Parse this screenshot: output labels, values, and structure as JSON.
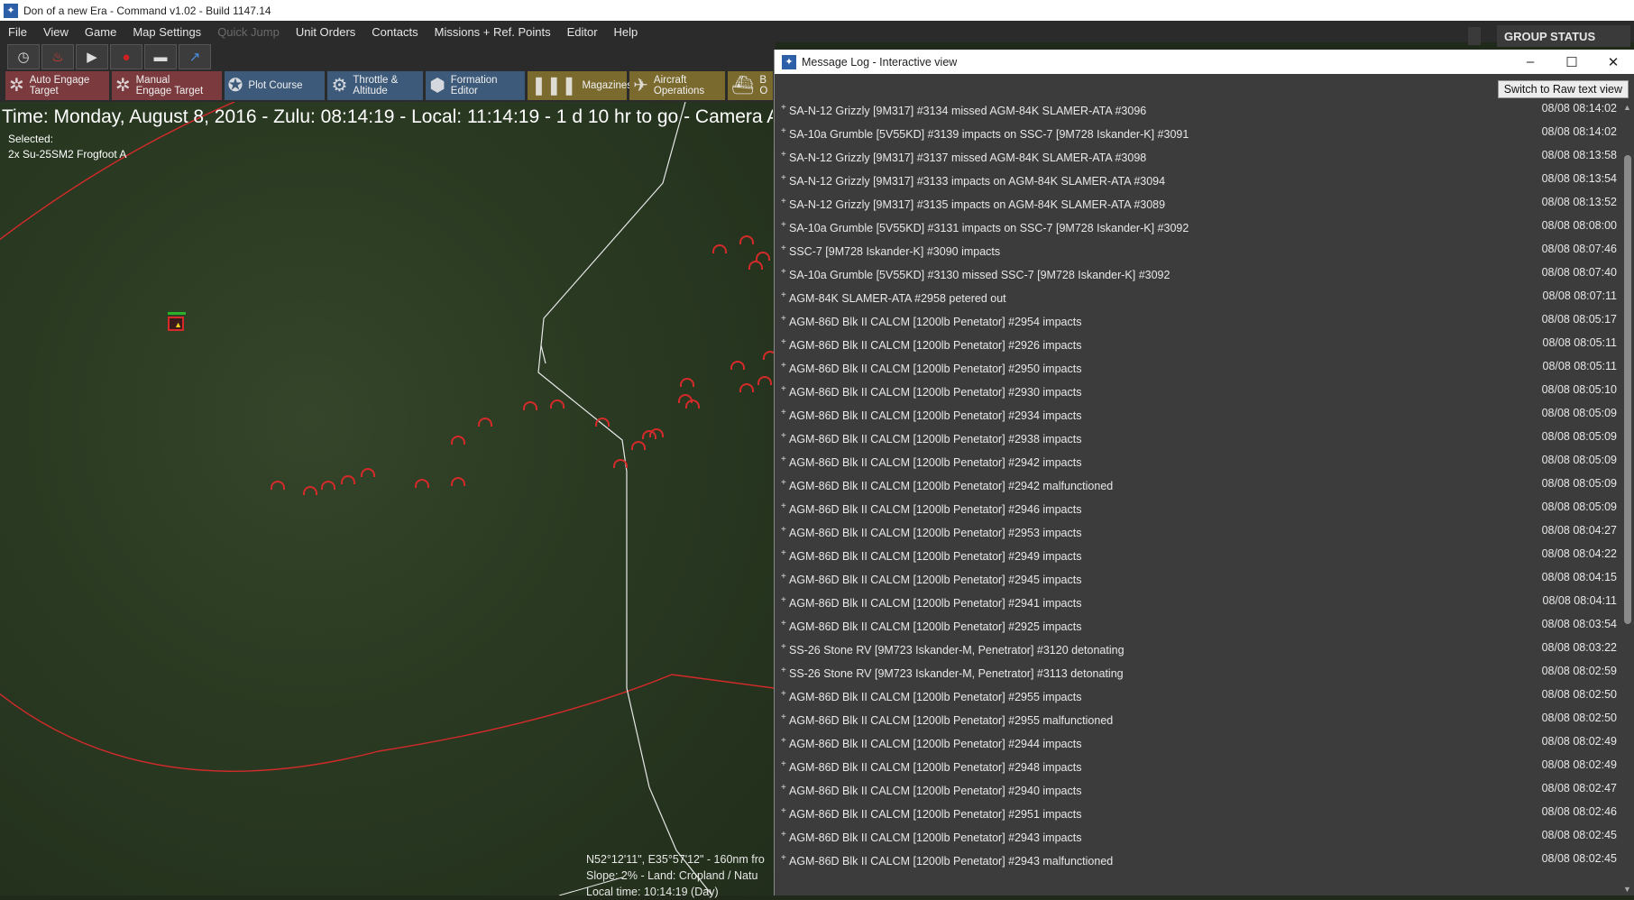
{
  "app": {
    "title": "Don of a new Era - Command v1.02 - Build 1147.14"
  },
  "menu": [
    "File",
    "View",
    "Game",
    "Map Settings",
    "Quick Jump",
    "Unit Orders",
    "Contacts",
    "Missions + Ref. Points",
    "Editor",
    "Help"
  ],
  "menu_disabled": [
    "Quick Jump"
  ],
  "toolbar_icons": [
    "clock-icon",
    "fire-icon",
    "play-icon",
    "record-icon",
    "ship-icon",
    "arrow-icon"
  ],
  "actions": [
    {
      "line1": "Auto Engage",
      "line2": "Target"
    },
    {
      "line1": "Manual",
      "line2": "Engage Target"
    },
    {
      "line1": "Plot Course",
      "line2": ""
    },
    {
      "line1": "Throttle &",
      "line2": "Altitude"
    },
    {
      "line1": "Formation",
      "line2": "Editor"
    },
    {
      "line1": "Magazines",
      "line2": ""
    },
    {
      "line1": "Aircraft",
      "line2": "Operations"
    },
    {
      "line1": "B",
      "line2": "O"
    }
  ],
  "map": {
    "time_line": "Time: Monday, August 8, 2016 - Zulu: 08:14:19 - Local: 11:14:19 - 1 d 10 hr to go -  Camera A",
    "selected_label": "Selected:",
    "selected_unit": "2x Su-25SM2 Frogfoot A",
    "coords_line1": "N52°12'11\", E35°57'12\" - 160nm fro",
    "coords_line2": "Slope: 2% - Land: Cropland / Natu",
    "coords_line3": "Local time: 10:14:19 (Day)"
  },
  "group_status": {
    "label": "GROUP STATUS"
  },
  "message_log": {
    "title": "Message Log - Interactive view",
    "raw_button": "Switch to Raw text view",
    "rows": [
      {
        "text": "SA-N-12 Grizzly [9M317] #3134 missed AGM-84K SLAMER-ATA #3096",
        "time": "08/08 08:14:02"
      },
      {
        "text": "SA-10a Grumble [5V55KD] #3139 impacts on SSC-7 [9M728 Iskander-K] #3091",
        "time": "08/08 08:14:02"
      },
      {
        "text": "SA-N-12 Grizzly [9M317] #3137 missed AGM-84K SLAMER-ATA #3098",
        "time": "08/08 08:13:58"
      },
      {
        "text": "SA-N-12 Grizzly [9M317] #3133 impacts on AGM-84K SLAMER-ATA #3094",
        "time": "08/08 08:13:54"
      },
      {
        "text": "SA-N-12 Grizzly [9M317] #3135 impacts on AGM-84K SLAMER-ATA #3089",
        "time": "08/08 08:13:52"
      },
      {
        "text": "SA-10a Grumble [5V55KD] #3131 impacts on SSC-7 [9M728 Iskander-K] #3092",
        "time": "08/08 08:08:00"
      },
      {
        "text": "SSC-7 [9M728 Iskander-K] #3090 impacts",
        "time": "08/08 08:07:46"
      },
      {
        "text": "SA-10a Grumble [5V55KD] #3130 missed SSC-7 [9M728 Iskander-K] #3092",
        "time": "08/08 08:07:40"
      },
      {
        "text": "AGM-84K SLAMER-ATA #2958 petered out",
        "time": "08/08 08:07:11"
      },
      {
        "text": "AGM-86D Blk II CALCM [1200lb Penetator] #2954 impacts",
        "time": "08/08 08:05:17"
      },
      {
        "text": "AGM-86D Blk II CALCM [1200lb Penetator] #2926 impacts",
        "time": "08/08 08:05:11"
      },
      {
        "text": "AGM-86D Blk II CALCM [1200lb Penetator] #2950 impacts",
        "time": "08/08 08:05:11"
      },
      {
        "text": "AGM-86D Blk II CALCM [1200lb Penetator] #2930 impacts",
        "time": "08/08 08:05:10"
      },
      {
        "text": "AGM-86D Blk II CALCM [1200lb Penetator] #2934 impacts",
        "time": "08/08 08:05:09"
      },
      {
        "text": "AGM-86D Blk II CALCM [1200lb Penetator] #2938 impacts",
        "time": "08/08 08:05:09"
      },
      {
        "text": "AGM-86D Blk II CALCM [1200lb Penetator] #2942 impacts",
        "time": "08/08 08:05:09"
      },
      {
        "text": "AGM-86D Blk II CALCM [1200lb Penetator] #2942 malfunctioned",
        "time": "08/08 08:05:09"
      },
      {
        "text": "AGM-86D Blk II CALCM [1200lb Penetator] #2946 impacts",
        "time": "08/08 08:05:09"
      },
      {
        "text": "AGM-86D Blk II CALCM [1200lb Penetator] #2953 impacts",
        "time": "08/08 08:04:27"
      },
      {
        "text": "AGM-86D Blk II CALCM [1200lb Penetator] #2949 impacts",
        "time": "08/08 08:04:22"
      },
      {
        "text": "AGM-86D Blk II CALCM [1200lb Penetator] #2945 impacts",
        "time": "08/08 08:04:15"
      },
      {
        "text": "AGM-86D Blk II CALCM [1200lb Penetator] #2941 impacts",
        "time": "08/08 08:04:11"
      },
      {
        "text": "AGM-86D Blk II CALCM [1200lb Penetator] #2925 impacts",
        "time": "08/08 08:03:54"
      },
      {
        "text": "SS-26 Stone RV [9M723 Iskander-M, Penetrator] #3120 detonating",
        "time": "08/08 08:03:22"
      },
      {
        "text": "SS-26 Stone RV [9M723 Iskander-M, Penetrator] #3113 detonating",
        "time": "08/08 08:02:59"
      },
      {
        "text": "AGM-86D Blk II CALCM [1200lb Penetator] #2955 impacts",
        "time": "08/08 08:02:50"
      },
      {
        "text": "AGM-86D Blk II CALCM [1200lb Penetator] #2955 malfunctioned",
        "time": "08/08 08:02:50"
      },
      {
        "text": "AGM-86D Blk II CALCM [1200lb Penetator] #2944 impacts",
        "time": "08/08 08:02:49"
      },
      {
        "text": "AGM-86D Blk II CALCM [1200lb Penetator] #2948 impacts",
        "time": "08/08 08:02:49"
      },
      {
        "text": "AGM-86D Blk II CALCM [1200lb Penetator] #2940 impacts",
        "time": "08/08 08:02:47"
      },
      {
        "text": "AGM-86D Blk II CALCM [1200lb Penetator] #2951 impacts",
        "time": "08/08 08:02:46"
      },
      {
        "text": "AGM-86D Blk II CALCM [1200lb Penetator] #2943 impacts",
        "time": "08/08 08:02:45"
      },
      {
        "text": "AGM-86D Blk II CALCM [1200lb Penetator] #2943 malfunctioned",
        "time": "08/08 08:02:45"
      }
    ]
  },
  "colors": {
    "range_ring": "#d42a2a",
    "border_line": "#e8e8e8",
    "unit_symbol": "#d42a2a",
    "log_bg": "#3c3c3c"
  }
}
